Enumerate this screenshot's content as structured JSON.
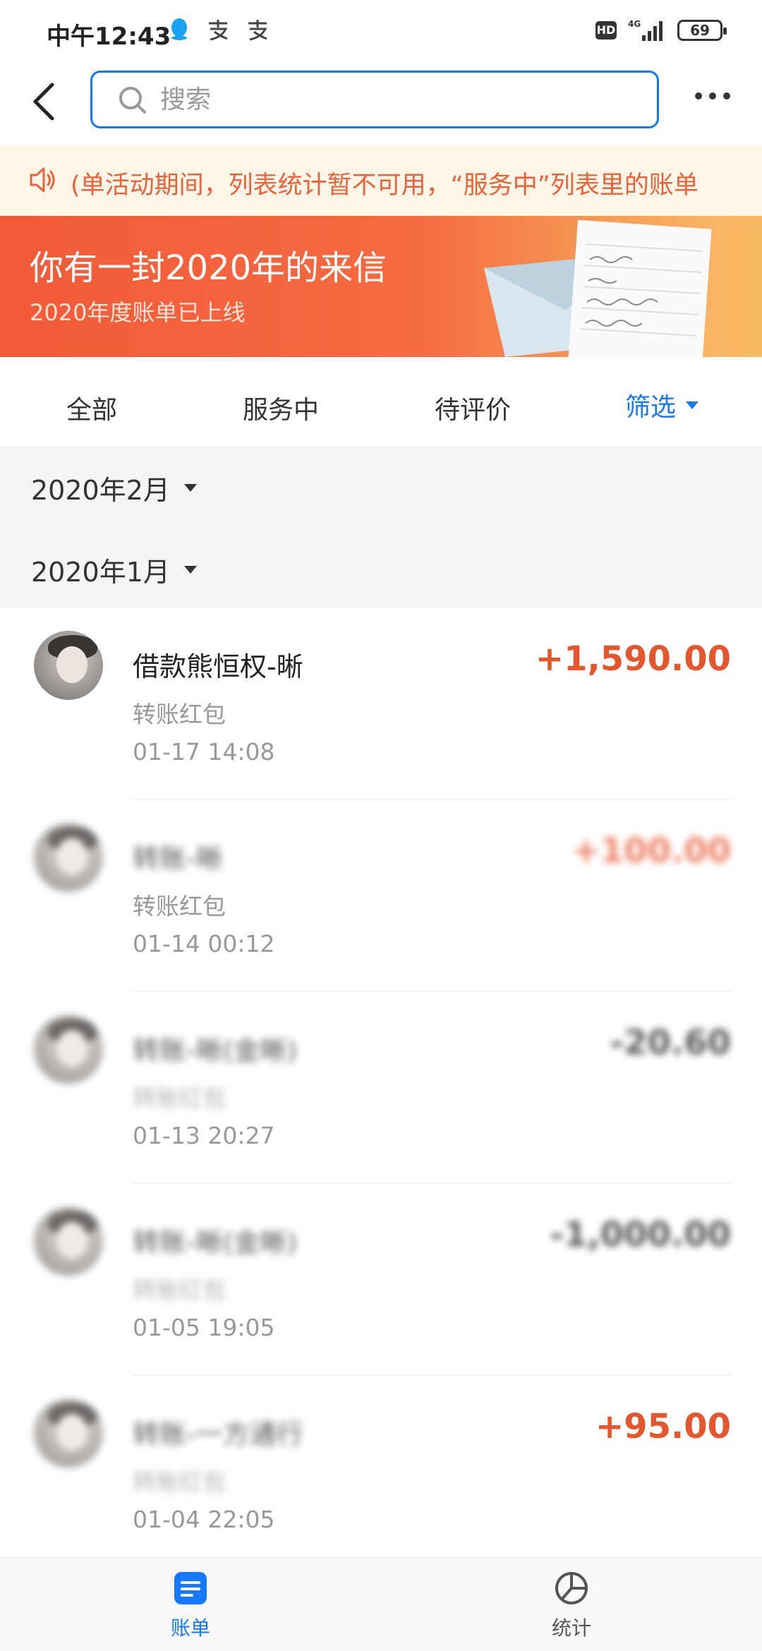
{
  "status_bar": {
    "time": "中午12:43",
    "network": "4G",
    "battery": "69"
  },
  "header": {
    "search_placeholder": "搜索"
  },
  "notice": {
    "text": "(单活动期间，列表统计暂不可用，“服务中”列表里的账单"
  },
  "banner": {
    "title": "你有一封2020年的来信",
    "subtitle": "2020年度账单已上线"
  },
  "tabs": {
    "all": "全部",
    "in_service": "服务中",
    "to_review": "待评价",
    "filter": "筛选"
  },
  "months": [
    {
      "label": "2020年2月"
    },
    {
      "label": "2020年1月"
    }
  ],
  "transactions": [
    {
      "title": "借款熊恒权-晰",
      "subtitle": "转账红包",
      "time": "01-17  14:08",
      "amount": "+1,590.00"
    },
    {
      "title": "转账-晰",
      "subtitle": "转账红包",
      "time": "01-14  00:12",
      "amount": "+100.00"
    },
    {
      "title": "转账-晰(金晰)",
      "subtitle": "转账红包",
      "time": "01-13  20:27",
      "amount": "-20.60"
    },
    {
      "title": "转账-晰(金晰)",
      "subtitle": "转账红包",
      "time": "01-05  19:05",
      "amount": "-1,000.00"
    },
    {
      "title": "转账-一方通行",
      "subtitle": "转账红包",
      "time": "01-04  22:05",
      "amount": "+95.00"
    }
  ],
  "bottom_nav": {
    "bills": "账单",
    "stats": "统计"
  },
  "colors": {
    "accent_blue": "#1677ff",
    "income_orange": "#e4572e",
    "banner_orange": "#f25a3a"
  }
}
